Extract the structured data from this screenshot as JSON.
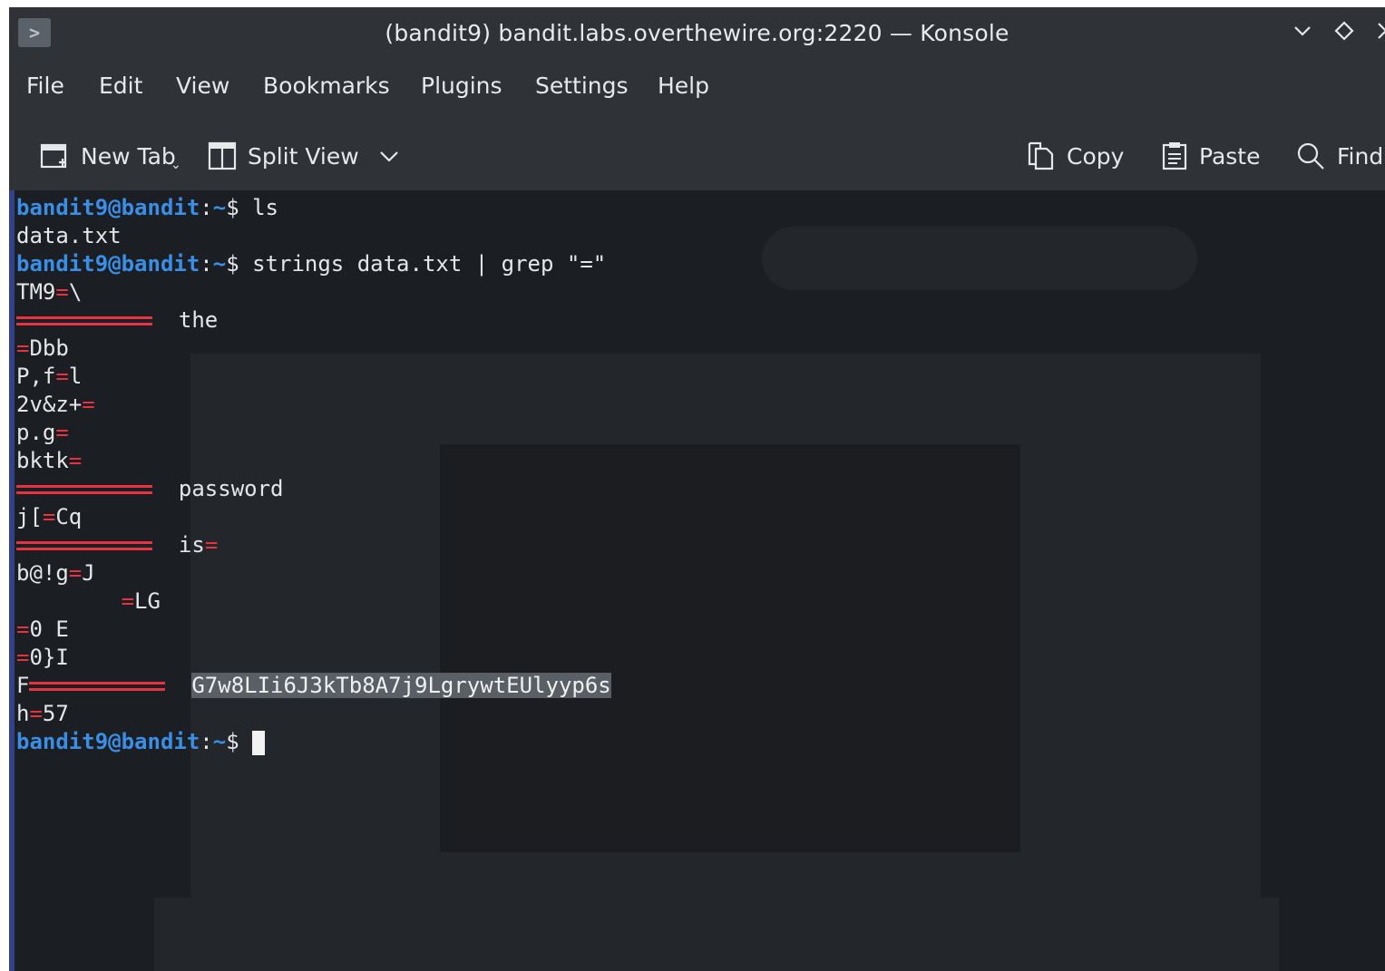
{
  "window": {
    "title": "(bandit9) bandit.labs.overthewire.org:2220 — Konsole",
    "controls": [
      "chevron-down-icon",
      "diamond-icon",
      "close-icon"
    ]
  },
  "menu": [
    "File",
    "Edit",
    "View",
    "Bookmarks",
    "Plugins",
    "Settings",
    "Help"
  ],
  "toolbar": {
    "new_tab": "New Tab",
    "split_view": "Split View",
    "copy": "Copy",
    "paste": "Paste",
    "find": "Find"
  },
  "terminal": {
    "user_host": "bandit9@bandit",
    "cwd": "~",
    "cmd1": "ls",
    "out1": "data.txt",
    "cmd2": "strings data.txt | grep \"=\"",
    "lines": {
      "l1a": "TM9",
      "l1b": "\\",
      "l2": "the",
      "l3": "Dbb",
      "l4a": "P,f",
      "l4b": "l",
      "l5": "2v&z+",
      "l6": "p.g",
      "l7": "bktk",
      "l8": "password",
      "l9a": "j[",
      "l9b": "Cq",
      "l10": "is",
      "l11a": "b@!g",
      "l11b": "J",
      "l12": "LG",
      "l13": "0 E",
      "l14": "0}I",
      "l15a": "F",
      "l15b": "G7w8LIi6J3kTb8A7j9LgrywtEUlyyp6s",
      "l16a": "h",
      "l16b": "57"
    },
    "colors": {
      "prompt": "#3a8ee6",
      "equals": "#e8323f",
      "text": "#e4e6e8"
    }
  }
}
